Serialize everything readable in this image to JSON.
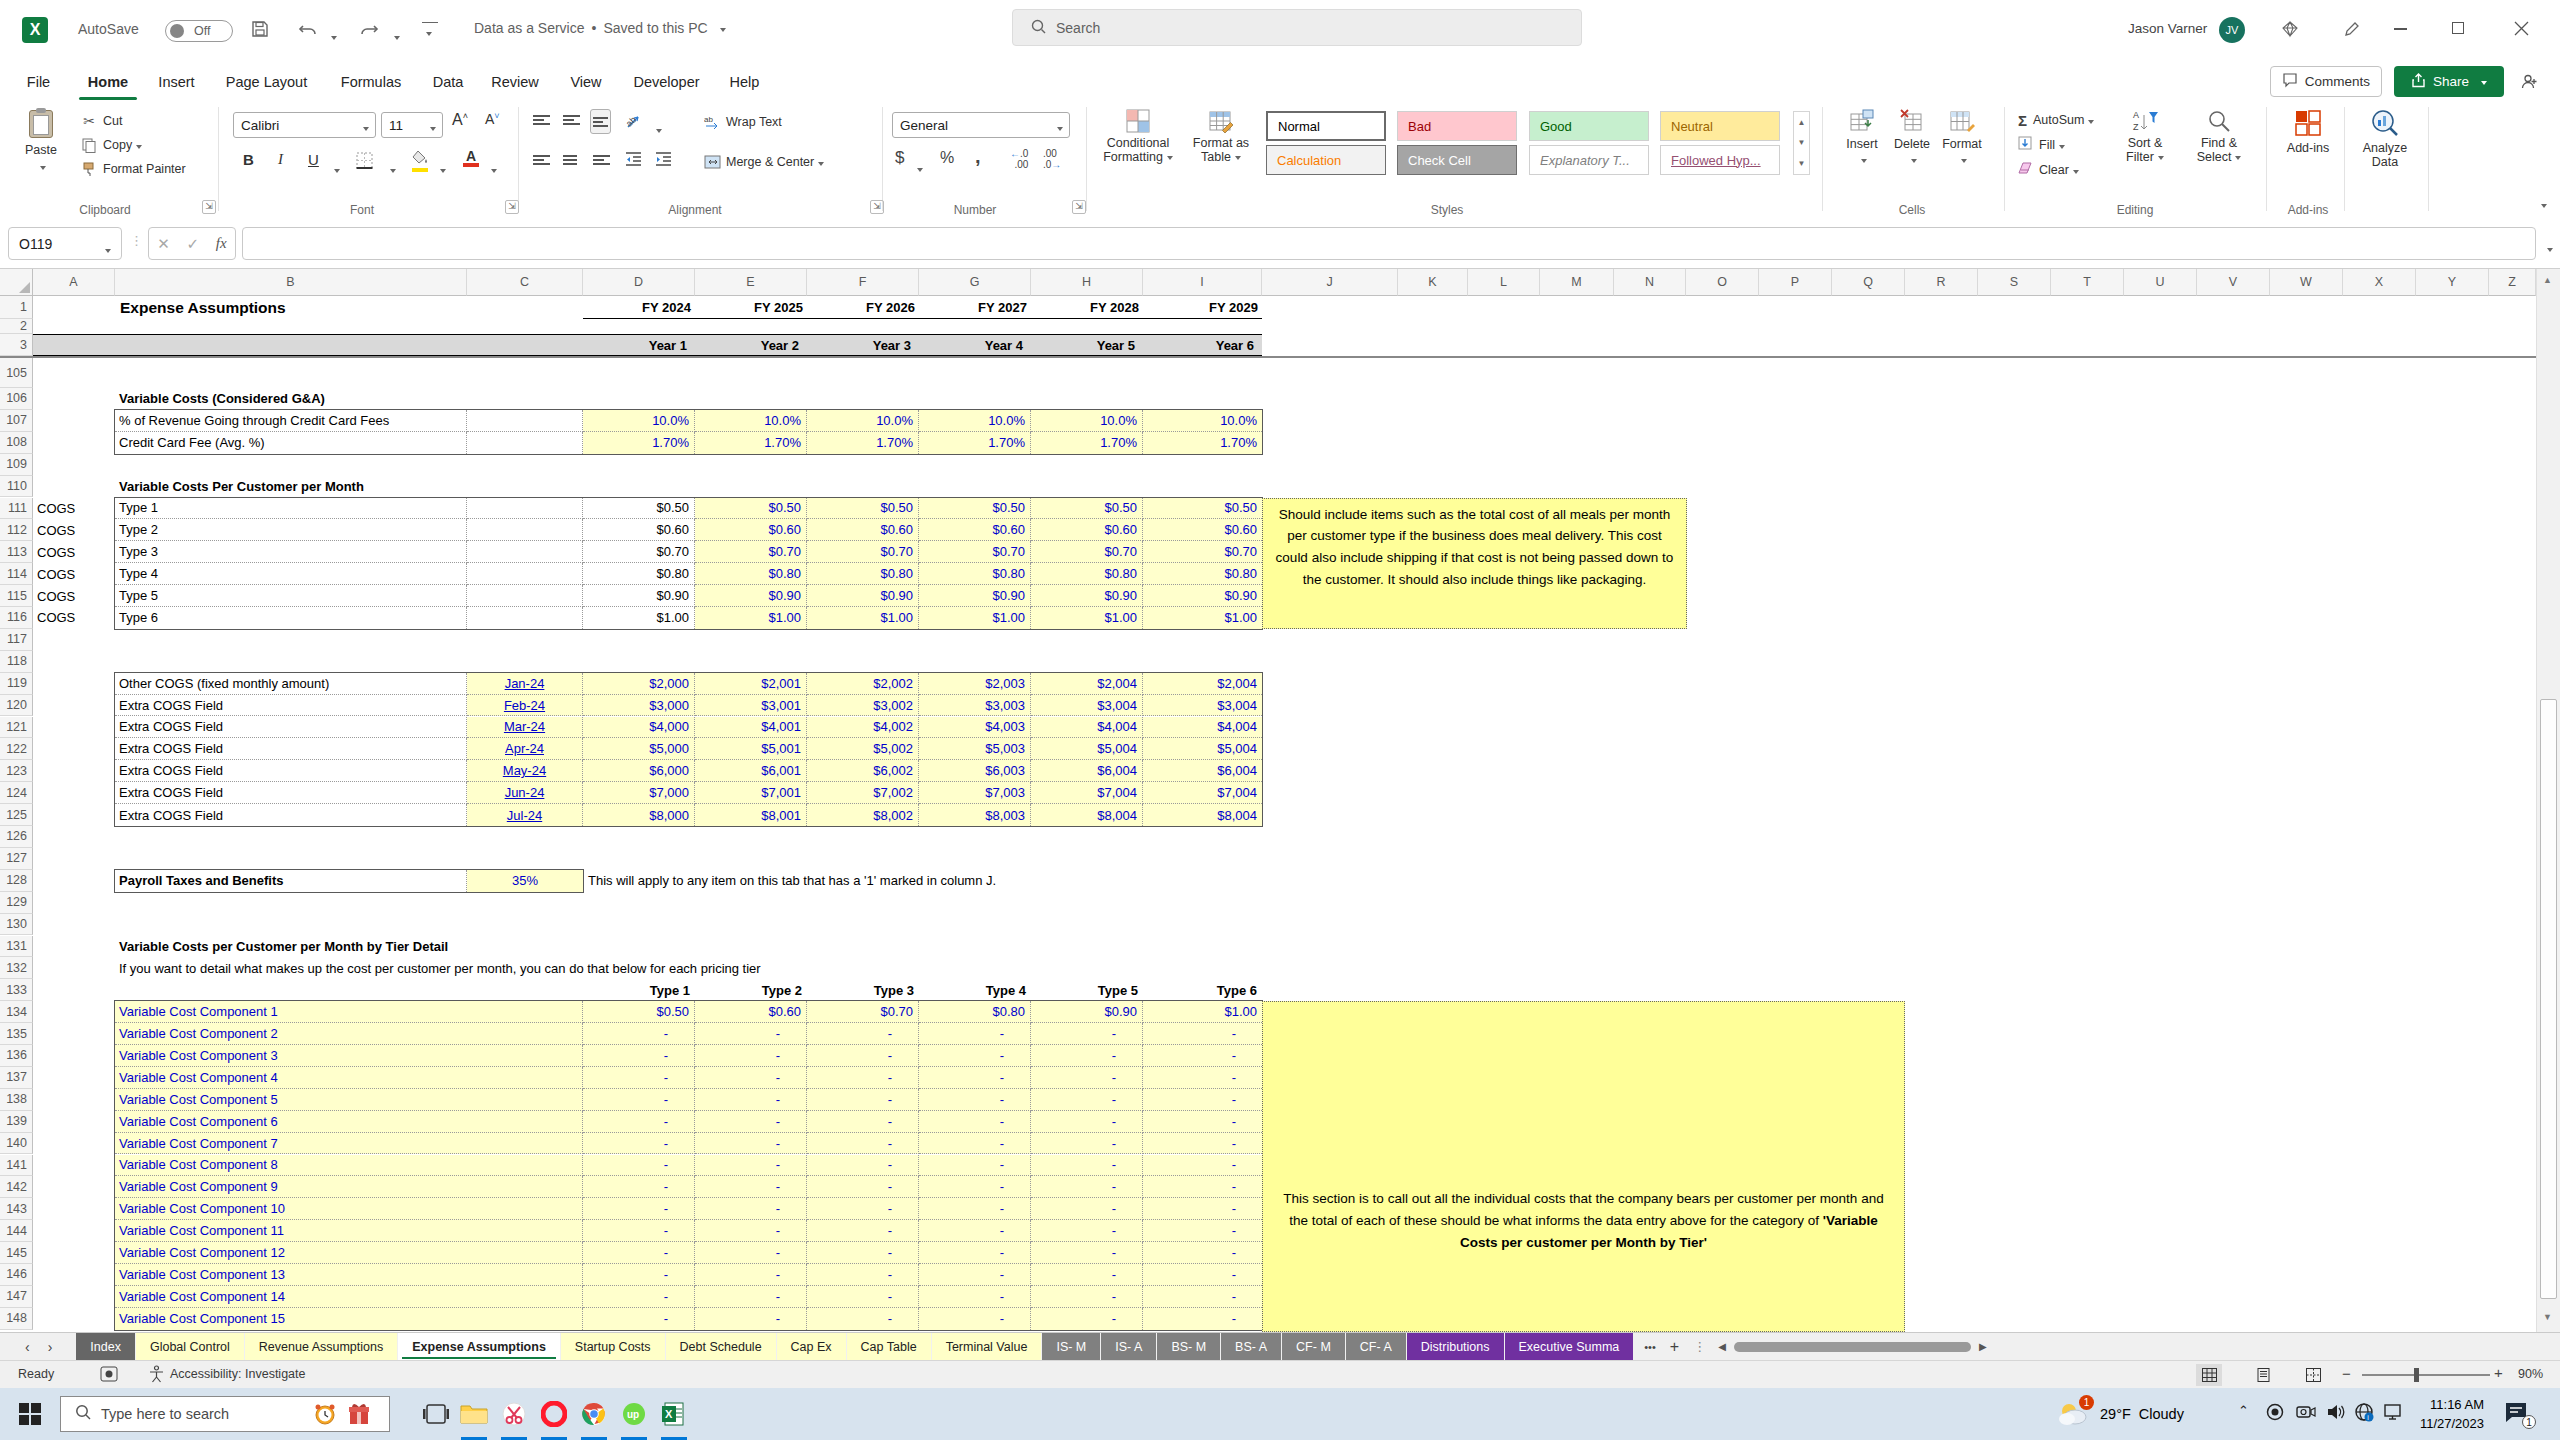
{
  "titlebar": {
    "autosave_label": "AutoSave",
    "autosave_state": "Off",
    "doc_title": "Data as a Service",
    "doc_status": "Saved to this PC",
    "search_placeholder": "Search",
    "user_name": "Jason Varner",
    "user_initials": "JV"
  },
  "ribbon_tabs": [
    {
      "label": "File",
      "active": false
    },
    {
      "label": "Home",
      "active": true
    },
    {
      "label": "Insert",
      "active": false
    },
    {
      "label": "Page Layout",
      "active": false
    },
    {
      "label": "Formulas",
      "active": false
    },
    {
      "label": "Data",
      "active": false
    },
    {
      "label": "Review",
      "active": false
    },
    {
      "label": "View",
      "active": false
    },
    {
      "label": "Developer",
      "active": false
    },
    {
      "label": "Help",
      "active": false
    }
  ],
  "top_right": {
    "comments": "Comments",
    "share": "Share"
  },
  "ribbon": {
    "clipboard": {
      "group": "Clipboard",
      "paste": "Paste",
      "cut": "Cut",
      "copy": "Copy",
      "format_painter": "Format Painter"
    },
    "font": {
      "group": "Font",
      "name": "Calibri",
      "size": "11"
    },
    "alignment": {
      "group": "Alignment",
      "wrap": "Wrap Text",
      "merge": "Merge & Center"
    },
    "number": {
      "group": "Number",
      "format": "General"
    },
    "styles": {
      "group": "Styles",
      "cf1": "Conditional",
      "cf2": "Formatting",
      "fat1": "Format as",
      "fat2": "Table",
      "gallery": [
        {
          "label": "Normal",
          "bg": "#ffffff",
          "fg": "#000000",
          "cls": "normal"
        },
        {
          "label": "Bad",
          "bg": "#FFC7CE",
          "fg": "#9C0006",
          "cls": ""
        },
        {
          "label": "Good",
          "bg": "#C6EFCE",
          "fg": "#006100",
          "cls": ""
        },
        {
          "label": "Neutral",
          "bg": "#FFEB9C",
          "fg": "#9C6500",
          "cls": ""
        },
        {
          "label": "Calculation",
          "bg": "#F2F2F2",
          "fg": "#FA7D00",
          "cls": "borderd"
        },
        {
          "label": "Check Cell",
          "bg": "#A5A5A5",
          "fg": "#ffffff",
          "cls": "borderd"
        },
        {
          "label": "Explanatory T...",
          "bg": "#ffffff",
          "fg": "#7F7F7F",
          "cls": "italic"
        },
        {
          "label": "Followed Hyp...",
          "bg": "#ffffff",
          "fg": "#954F72",
          "cls": "underl"
        }
      ]
    },
    "cells": {
      "group": "Cells",
      "insert": "Insert",
      "delete": "Delete",
      "format": "Format"
    },
    "editing": {
      "group": "Editing",
      "autosum": "AutoSum",
      "fill": "Fill",
      "clear": "Clear",
      "sort1": "Sort &",
      "sort2": "Filter",
      "find1": "Find &",
      "find2": "Select"
    },
    "addins": {
      "group": "Add-ins",
      "addins": "Add-ins",
      "analyze1": "Analyze",
      "analyze2": "Data"
    }
  },
  "formula_bar": {
    "name_box": "O119",
    "formula": ""
  },
  "grid": {
    "columns": [
      "A",
      "B",
      "C",
      "D",
      "E",
      "F",
      "G",
      "H",
      "I",
      "J",
      "K",
      "L",
      "M",
      "N",
      "O",
      "P",
      "Q",
      "R",
      "S",
      "T",
      "U",
      "V",
      "W",
      "X",
      "Y",
      "Z"
    ],
    "title": "Expense Assumptions",
    "fy_headers": [
      "FY 2024",
      "FY 2025",
      "FY 2026",
      "FY 2027",
      "FY 2028",
      "FY 2029"
    ],
    "year_headers": [
      "Year 1",
      "Year 2",
      "Year 3",
      "Year 4",
      "Year 5",
      "Year 6"
    ],
    "sections": {
      "s106": "Variable Costs (Considered G&A)",
      "s110": "Variable Costs Per Customer per Month",
      "s131": "Variable Costs per Customer per Month by Tier Detail",
      "s132": "If you want to detail what makes up the cost per customer per month, you can do that  below for each pricing tier"
    },
    "credit_table": [
      {
        "row": 107,
        "label": "% of Revenue Going through Credit Card Fees",
        "values": [
          "10.0%",
          "10.0%",
          "10.0%",
          "10.0%",
          "10.0%",
          "10.0%"
        ]
      },
      {
        "row": 108,
        "label": "Credit Card Fee (Avg. %)",
        "values": [
          "1.70%",
          "1.70%",
          "1.70%",
          "1.70%",
          "1.70%",
          "1.70%"
        ]
      }
    ],
    "cogs_table": [
      {
        "row": 111,
        "a": "COGS",
        "label": "Type 1",
        "d": "$0.50",
        "values": [
          "$0.50",
          "$0.50",
          "$0.50",
          "$0.50",
          "$0.50"
        ]
      },
      {
        "row": 112,
        "a": "COGS",
        "label": "Type 2",
        "d": "$0.60",
        "values": [
          "$0.60",
          "$0.60",
          "$0.60",
          "$0.60",
          "$0.60"
        ]
      },
      {
        "row": 113,
        "a": "COGS",
        "label": "Type 3",
        "d": "$0.70",
        "values": [
          "$0.70",
          "$0.70",
          "$0.70",
          "$0.70",
          "$0.70"
        ]
      },
      {
        "row": 114,
        "a": "COGS",
        "label": "Type 4",
        "d": "$0.80",
        "values": [
          "$0.80",
          "$0.80",
          "$0.80",
          "$0.80",
          "$0.80"
        ]
      },
      {
        "row": 115,
        "a": "COGS",
        "label": "Type 5",
        "d": "$0.90",
        "values": [
          "$0.90",
          "$0.90",
          "$0.90",
          "$0.90",
          "$0.90"
        ]
      },
      {
        "row": 116,
        "a": "COGS",
        "label": "Type 6",
        "d": "$1.00",
        "values": [
          "$1.00",
          "$1.00",
          "$1.00",
          "$1.00",
          "$1.00"
        ]
      }
    ],
    "note1": "Should include items such as the total cost of all meals per month per customer type if the business does meal delivery. This cost could also include shipping if that cost is not being passed down to the customer. It should also include things like packaging.",
    "other_cogs_table": [
      {
        "row": 119,
        "label": "Other COGS (fixed monthly amount)",
        "date": "Jan-24",
        "values": [
          "$2,000",
          "$2,001",
          "$2,002",
          "$2,003",
          "$2,004",
          "$2,004"
        ]
      },
      {
        "row": 120,
        "label": "Extra COGS Field",
        "date": "Feb-24",
        "values": [
          "$3,000",
          "$3,001",
          "$3,002",
          "$3,003",
          "$3,004",
          "$3,004"
        ]
      },
      {
        "row": 121,
        "label": "Extra COGS Field",
        "date": "Mar-24",
        "values": [
          "$4,000",
          "$4,001",
          "$4,002",
          "$4,003",
          "$4,004",
          "$4,004"
        ]
      },
      {
        "row": 122,
        "label": "Extra COGS Field",
        "date": "Apr-24",
        "values": [
          "$5,000",
          "$5,001",
          "$5,002",
          "$5,003",
          "$5,004",
          "$5,004"
        ]
      },
      {
        "row": 123,
        "label": "Extra COGS Field",
        "date": "May-24",
        "values": [
          "$6,000",
          "$6,001",
          "$6,002",
          "$6,003",
          "$6,004",
          "$6,004"
        ]
      },
      {
        "row": 124,
        "label": "Extra COGS Field",
        "date": "Jun-24",
        "values": [
          "$7,000",
          "$7,001",
          "$7,002",
          "$7,003",
          "$7,004",
          "$7,004"
        ]
      },
      {
        "row": 125,
        "label": "Extra COGS Field",
        "date": "Jul-24",
        "values": [
          "$8,000",
          "$8,001",
          "$8,002",
          "$8,003",
          "$8,004",
          "$8,004"
        ]
      }
    ],
    "payroll": {
      "row": 128,
      "label": "Payroll Taxes and Benefits",
      "value": "35%",
      "note": "This will apply to any item on this tab that has a '1' marked in column J."
    },
    "type_headers": [
      "Type 1",
      "Type 2",
      "Type 3",
      "Type 4",
      "Type 5",
      "Type 6"
    ],
    "component_rows": [
      {
        "row": 134,
        "label": "Variable Cost Component 1",
        "values": [
          "$0.50",
          "$0.60",
          "$0.70",
          "$0.80",
          "$0.90",
          "$1.00"
        ]
      },
      {
        "row": 135,
        "label": "Variable Cost Component 2",
        "values": [
          "-",
          "-",
          "-",
          "-",
          "-",
          "-"
        ]
      },
      {
        "row": 136,
        "label": "Variable Cost Component 3",
        "values": [
          "-",
          "-",
          "-",
          "-",
          "-",
          "-"
        ]
      },
      {
        "row": 137,
        "label": "Variable Cost Component 4",
        "values": [
          "-",
          "-",
          "-",
          "-",
          "-",
          "-"
        ]
      },
      {
        "row": 138,
        "label": "Variable Cost Component 5",
        "values": [
          "-",
          "-",
          "-",
          "-",
          "-",
          "-"
        ]
      },
      {
        "row": 139,
        "label": "Variable Cost Component 6",
        "values": [
          "-",
          "-",
          "-",
          "-",
          "-",
          "-"
        ]
      },
      {
        "row": 140,
        "label": "Variable Cost Component 7",
        "values": [
          "-",
          "-",
          "-",
          "-",
          "-",
          "-"
        ]
      },
      {
        "row": 141,
        "label": "Variable Cost Component 8",
        "values": [
          "-",
          "-",
          "-",
          "-",
          "-",
          "-"
        ]
      },
      {
        "row": 142,
        "label": "Variable Cost Component 9",
        "values": [
          "-",
          "-",
          "-",
          "-",
          "-",
          "-"
        ]
      },
      {
        "row": 143,
        "label": "Variable Cost Component 10",
        "values": [
          "-",
          "-",
          "-",
          "-",
          "-",
          "-"
        ]
      },
      {
        "row": 144,
        "label": "Variable Cost Component 11",
        "values": [
          "-",
          "-",
          "-",
          "-",
          "-",
          "-"
        ]
      },
      {
        "row": 145,
        "label": "Variable Cost Component 12",
        "values": [
          "-",
          "-",
          "-",
          "-",
          "-",
          "-"
        ]
      },
      {
        "row": 146,
        "label": "Variable Cost Component 13",
        "values": [
          "-",
          "-",
          "-",
          "-",
          "-",
          "-"
        ]
      },
      {
        "row": 147,
        "label": "Variable Cost Component 14",
        "values": [
          "-",
          "-",
          "-",
          "-",
          "-",
          "-"
        ]
      },
      {
        "row": 148,
        "label": "Variable Cost Component 15",
        "values": [
          "-",
          "-",
          "-",
          "-",
          "-",
          "-"
        ]
      }
    ],
    "note2_plain": "This section is to call out all the individual costs that the company bears per customer per month and the total of each of these should be what informs the data entry above for the category of ",
    "note2_bold": "'Variable Costs per customer per Month by Tier'"
  },
  "sheet_tabs": [
    {
      "label": "Index",
      "type": "graydark"
    },
    {
      "label": "Global Control",
      "type": "yellow"
    },
    {
      "label": "Revenue Assumptions",
      "type": "yellow"
    },
    {
      "label": "Expense Assumptions",
      "type": "active"
    },
    {
      "label": "Startup Costs",
      "type": "yellow"
    },
    {
      "label": "Debt Schedule",
      "type": "yellow"
    },
    {
      "label": "Cap Ex",
      "type": "yellow"
    },
    {
      "label": "Cap Table",
      "type": "yellow"
    },
    {
      "label": "Terminal Value",
      "type": "yellow"
    },
    {
      "label": "IS- M",
      "type": "gray"
    },
    {
      "label": "IS- A",
      "type": "gray"
    },
    {
      "label": "BS- M",
      "type": "gray"
    },
    {
      "label": "BS- A",
      "type": "gray"
    },
    {
      "label": "CF- M",
      "type": "gray"
    },
    {
      "label": "CF- A",
      "type": "gray"
    },
    {
      "label": "Distributions",
      "type": "purple"
    },
    {
      "label": "Executive Summa",
      "type": "purple"
    }
  ],
  "status_bar": {
    "ready": "Ready",
    "accessibility": "Accessibility: Investigate",
    "zoom_level": "90%"
  },
  "taskbar": {
    "search_placeholder": "Type here to search",
    "weather_temp": "29°F",
    "weather_condition": "Cloudy",
    "time": "11:16 AM",
    "date": "11/27/2023",
    "weather_badge": "1",
    "tray_badge": "1"
  }
}
